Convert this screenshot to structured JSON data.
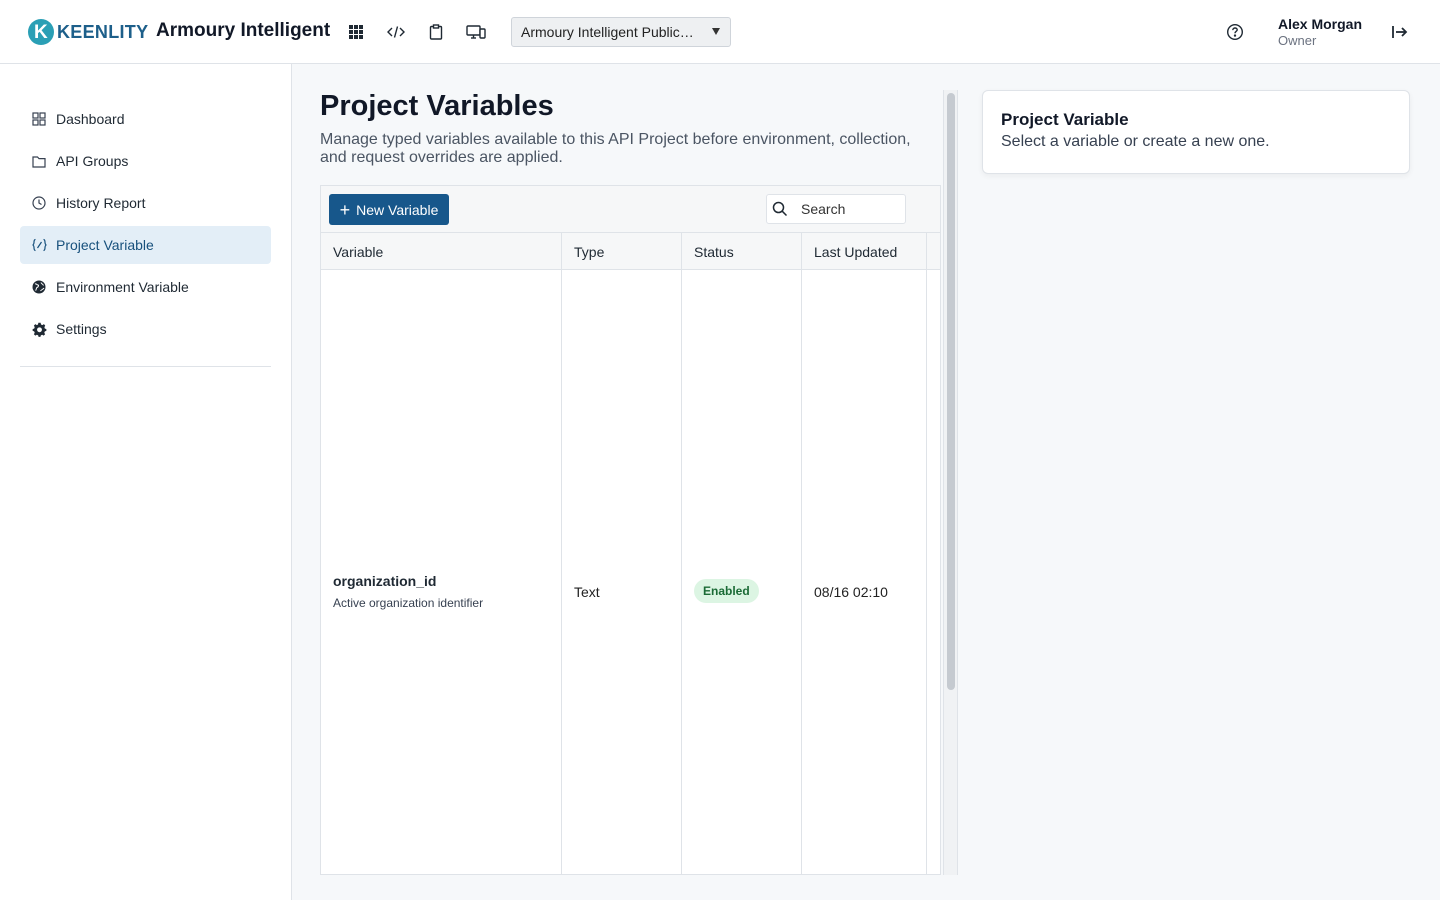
{
  "header": {
    "logo_text": "KEENLITY",
    "app_title": "Armoury Intelligent",
    "icons": [
      "grid-icon",
      "code-icon",
      "clipboard-icon",
      "devices-icon"
    ],
    "project_select_value": "Armoury Intelligent Public…",
    "help_icon": "help-icon",
    "user_name": "Alex Morgan",
    "user_role": "Owner",
    "logout_icon": "logout-icon"
  },
  "sidebar": {
    "items": [
      {
        "label": "Dashboard",
        "icon": "dashboard-icon",
        "active": false
      },
      {
        "label": "API Groups",
        "icon": "folder-icon",
        "active": false
      },
      {
        "label": "History Report",
        "icon": "clock-icon",
        "active": false
      },
      {
        "label": "Project Variable",
        "icon": "variable-icon",
        "active": true
      },
      {
        "label": "Environment Variable",
        "icon": "globe-icon",
        "active": false
      },
      {
        "label": "Settings",
        "icon": "gear-icon",
        "active": false
      }
    ]
  },
  "main": {
    "title": "Project Variables",
    "description": "Manage typed variables available to this API Project before environment, collection, and request overrides are applied.",
    "new_button_label": "New Variable",
    "search_placeholder": "Search",
    "columns": [
      "Variable",
      "Type",
      "Status",
      "Last Updated"
    ],
    "rows": [
      {
        "name": "organization_id",
        "description": "Active organization identifier",
        "type": "Text",
        "status": "Enabled",
        "last_updated": "08/16 02:10"
      }
    ]
  },
  "detail": {
    "title": "Project Variable",
    "subtitle": "Select a variable or create a new one."
  },
  "colors": {
    "accent": "#17578b",
    "active_nav_bg": "#e3eef7",
    "badge_bg": "#dcf5e3",
    "badge_text": "#1b6b36"
  }
}
